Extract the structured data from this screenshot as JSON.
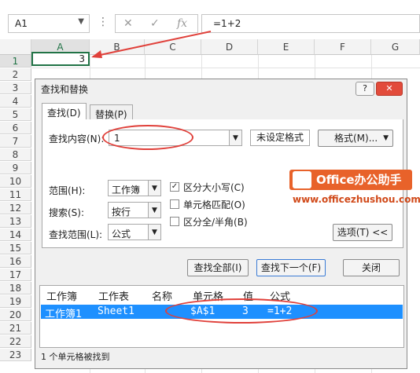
{
  "formula_bar": {
    "name_box": "A1",
    "cancel_icon": "✕",
    "enter_icon": "✓",
    "fx_icon": "fx",
    "formula": "=1+2"
  },
  "sheet": {
    "columns": [
      "A",
      "B",
      "C",
      "D",
      "E",
      "F",
      "G"
    ],
    "rows": [
      "1",
      "2",
      "3",
      "4",
      "5",
      "6",
      "7",
      "8",
      "9",
      "10",
      "11",
      "12",
      "13",
      "14",
      "15",
      "16",
      "17",
      "18",
      "19",
      "20",
      "21",
      "22",
      "23"
    ],
    "a1_value": "3"
  },
  "dialog": {
    "title": "查找和替换",
    "help_label": "?",
    "close_label": "✕",
    "tabs": [
      {
        "label": "查找(D)"
      },
      {
        "label": "替换(P)"
      }
    ],
    "find_label": "查找内容(N):",
    "find_value": "1",
    "no_format_label": "未设定格式",
    "format_button": "格式(M)...",
    "within_label": "范围(H):",
    "within_value": "工作簿",
    "search_label": "搜索(S):",
    "search_value": "按行",
    "lookin_label": "查找范围(L):",
    "lookin_value": "公式",
    "match_case": {
      "label": "区分大小写(C)",
      "checked": true
    },
    "match_entire": {
      "label": "单元格匹配(O)",
      "checked": false
    },
    "match_byte": {
      "label": "区分全/半角(B)",
      "checked": false
    },
    "options_button": "选项(T) <<",
    "find_all_button": "查找全部(I)",
    "find_next_button": "查找下一个(F)",
    "close_button": "关闭",
    "results": {
      "headers": [
        "工作簿",
        "工作表",
        "名称",
        "单元格",
        "值",
        "公式"
      ],
      "rows": [
        {
          "book": "工作簿1",
          "sheet": "Sheet1",
          "name": "",
          "cell": "$A$1",
          "value": "3",
          "formula": "=1+2"
        }
      ]
    },
    "status": "1 个单元格被找到"
  },
  "watermark": {
    "brand": "Office办公助手",
    "url": "www.officezhushou.com"
  },
  "colors": {
    "selection_blue": "#1e90ff",
    "annotation_red": "#e0403a",
    "excel_green": "#217346",
    "watermark_orange": "#e8622a"
  }
}
